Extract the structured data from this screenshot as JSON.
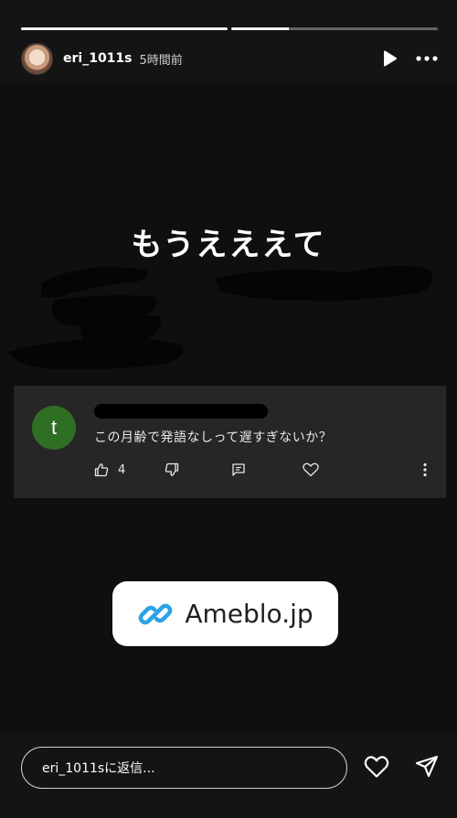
{
  "progress": [
    {
      "fill": 1.0
    },
    {
      "fill": 0.28
    }
  ],
  "header": {
    "username": "eri_1011s",
    "time": "5時間前",
    "play_icon": "play-icon",
    "more_icon": "more-horizontal-icon"
  },
  "story": {
    "headline": "もうえええて",
    "comment": {
      "avatar_letter": "t",
      "text": "この月齢で発語なしって遅すぎないか？",
      "like_count": "4",
      "icons": [
        "thumbs-up-icon",
        "thumbs-down-icon",
        "reply-icon",
        "heart-icon",
        "more-vertical-icon"
      ]
    },
    "link_sticker": {
      "text": "Ameblo.jp",
      "icon": "link-icon",
      "accent": "#2aa3e6"
    }
  },
  "footer": {
    "reply_placeholder": "eri_1011sに返信...",
    "heart_icon": "heart-icon",
    "send_icon": "send-icon"
  },
  "colors": {
    "background": "#141414",
    "card": "#262626",
    "avatar_green": "#2f6f24"
  }
}
